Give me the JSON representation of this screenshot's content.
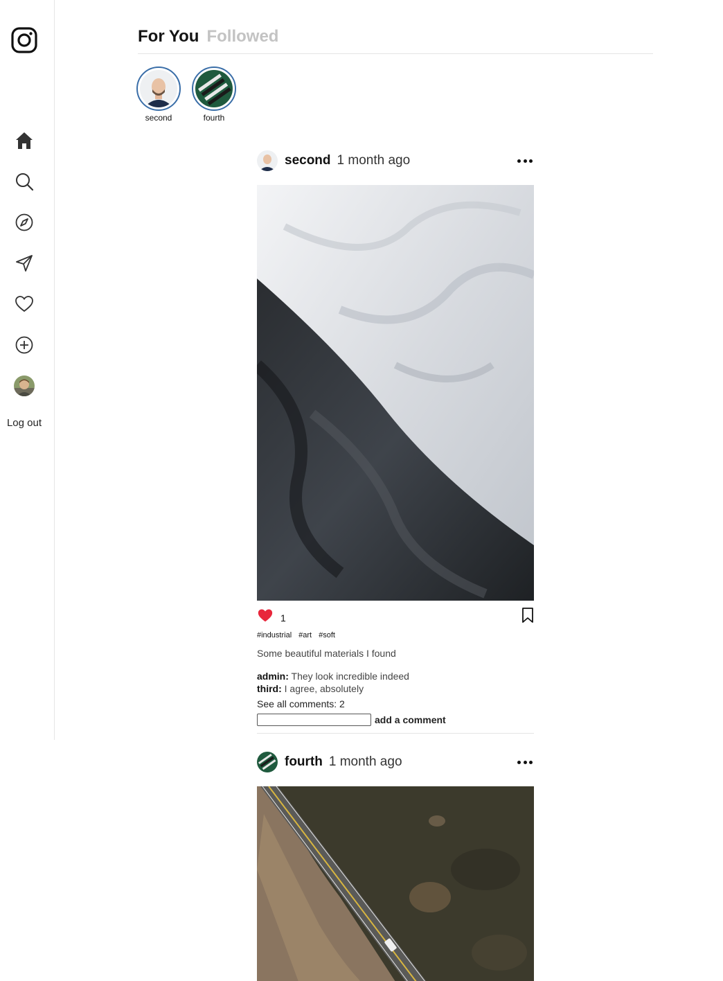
{
  "sidebar": {
    "logo": "instagram-logo",
    "items": [
      "home-icon",
      "search-icon",
      "explore-icon",
      "messages-icon",
      "notifications-icon",
      "create-icon"
    ],
    "logout_label": "Log out"
  },
  "tabs": {
    "for_you": "For You",
    "followed": "Followed"
  },
  "stories": [
    {
      "name": "second"
    },
    {
      "name": "fourth"
    }
  ],
  "posts": [
    {
      "user": "second",
      "time": "1 month ago",
      "likes": "1",
      "tags": [
        "#industrial",
        "#art",
        "#soft"
      ],
      "caption": "Some beautiful materials I found",
      "comments": [
        {
          "user": "admin:",
          "text": "They look incredible indeed"
        },
        {
          "user": "third:",
          "text": "I agree, absolutely"
        }
      ],
      "see_all": "See all comments: 2",
      "add_comment": "add a comment"
    },
    {
      "user": "fourth",
      "time": "1 month ago"
    }
  ],
  "colors": {
    "like": "#e8263b",
    "story_ring": "#3a6ea8",
    "inactive_tab": "#c3c3c3"
  }
}
